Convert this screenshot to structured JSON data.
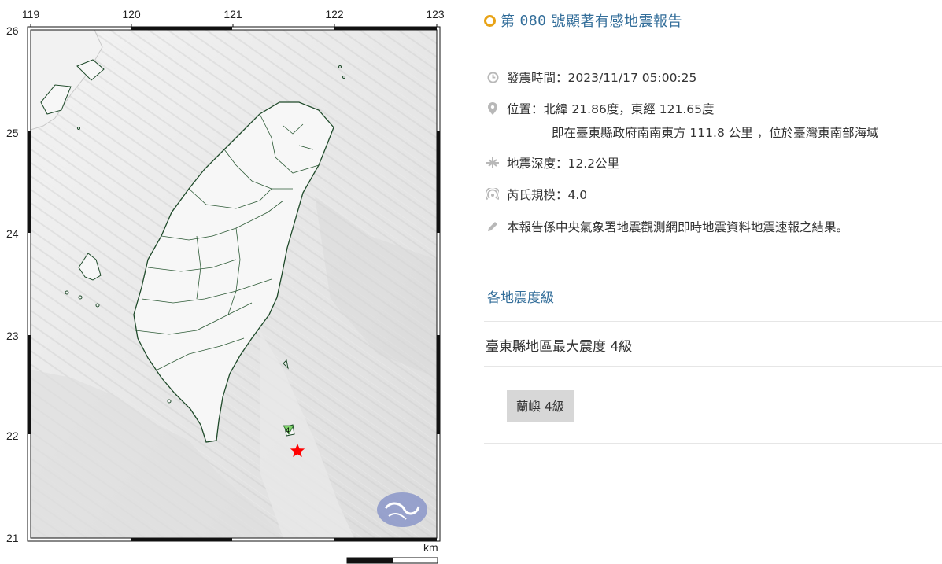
{
  "map": {
    "longitude_labels": [
      "119",
      "120",
      "121",
      "122",
      "123"
    ],
    "latitude_labels": [
      "26",
      "25",
      "24",
      "23",
      "22",
      "21"
    ],
    "scale_unit": "km",
    "epicenter": {
      "lat": 21.86,
      "lon": 121.65
    },
    "epicenter_color": "#ff0000",
    "station_marker_label": "4"
  },
  "report": {
    "title_prefix": "第",
    "title_number": "080",
    "title_suffix": "號顯著有感地震報告",
    "time": "發震時間：2023/11/17 05:00:25",
    "location": "位置：北緯 21.86度，東經 121.65度",
    "location_detail": "即在臺東縣政府南南東方 111.8 公里 ，位於臺灣東南部海域",
    "depth": "地震深度：12.2公里",
    "magnitude": "芮氏規模：4.0",
    "note": "本報告係中央氣象署地震觀測網即時地震資料地震速報之結果。",
    "section_title": "各地震度級",
    "max_intensity": "臺東縣地區最大震度 4級",
    "station": "蘭嶼 4級"
  },
  "colors": {
    "title": "#336e9a",
    "accent_dot": "#e8a317",
    "icon": "#b8b8b8",
    "badge": "#d7d7d7"
  }
}
